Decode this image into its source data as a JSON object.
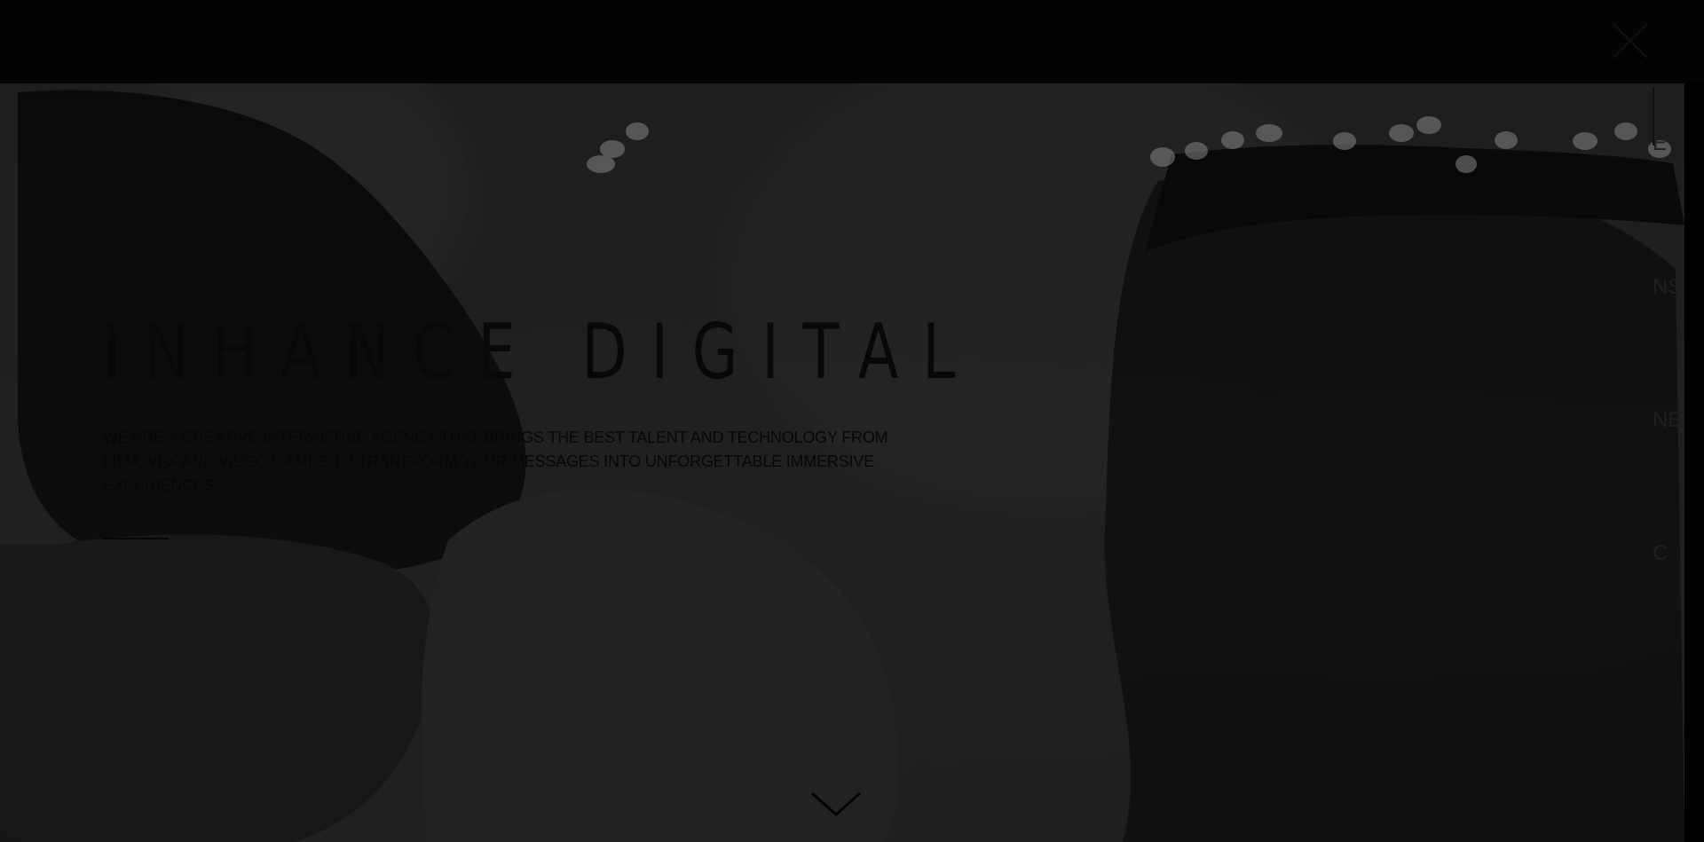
{
  "hero": {
    "title": "INHANCE DIGITAL",
    "description": "WE ARE A CREATIVE INTERACTIVE AGENCY THAT BRINGS THE BEST TALENT AND TECHNOLOGY FROM FILM, VFX AND VIDEO GAMES TO TRANSFORM YOUR MESSAGES INTO UNFORGETTABLE IMMERSIVE EXPERIENCES."
  },
  "controls": {
    "close_icon": "close-icon",
    "scroll_icon": "chevron-down-icon"
  },
  "right_menu": {
    "items": [
      "E",
      "NS",
      "NE",
      "C"
    ]
  },
  "colors": {
    "background": "#000000",
    "hero_base": "#2a2a2a",
    "text": "#080808"
  }
}
